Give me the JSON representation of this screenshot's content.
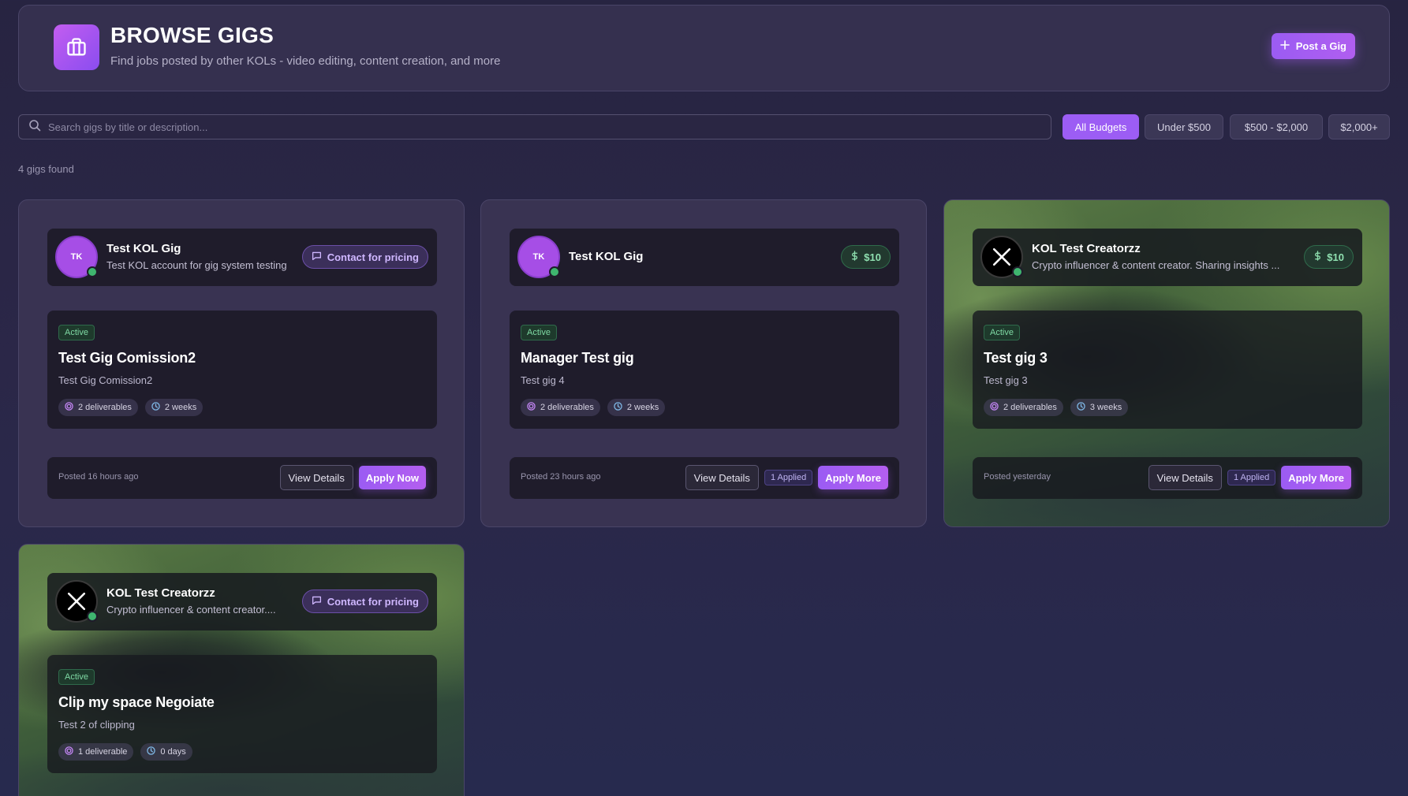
{
  "header": {
    "title": "BROWSE GIGS",
    "subtitle": "Find jobs posted by other KOLs - video editing, content creation, and more",
    "post_button": "Post a Gig",
    "icon": "briefcase-icon"
  },
  "search": {
    "placeholder": "Search gigs by title or description...",
    "value": ""
  },
  "filters": [
    "All Budgets",
    "Under $500",
    "$500 - $2,000",
    "$2,000+"
  ],
  "active_filter": "All Budgets",
  "results_count": "4 gigs found",
  "colors": {
    "accent": "#9c5df4",
    "active_status": "#7fd9a4",
    "online": "#3fb56f"
  },
  "gigs": [
    {
      "author": {
        "initials": "TK",
        "name": "Test KOL Gig",
        "bio": "Test KOL account for gig system testing",
        "avatar": "initials"
      },
      "price": "Contact for pricing",
      "status": "Active",
      "title": "Test Gig Comission2",
      "description": "Test Gig Comission2",
      "deliverables": "2 deliverables",
      "duration": "2 weeks",
      "posted": "Posted 16 hours ago",
      "applied": "",
      "view_label": "View Details",
      "apply_label": "Apply Now"
    },
    {
      "author": {
        "initials": "TK",
        "name": "Test KOL Gig",
        "bio": "",
        "avatar": "initials"
      },
      "price": "$10",
      "status": "Active",
      "title": "Manager Test gig",
      "description": "Test gig 4",
      "deliverables": "2 deliverables",
      "duration": "2 weeks",
      "posted": "Posted 23 hours ago",
      "applied": "1 Applied",
      "view_label": "View Details",
      "apply_label": "Apply More"
    },
    {
      "author": {
        "initials": "X",
        "name": "KOL Test Creatorzz",
        "bio": "Crypto influencer & content creator. Sharing insights ...",
        "avatar": "x-logo"
      },
      "price": "$10",
      "status": "Active",
      "title": "Test gig 3",
      "description": "Test gig 3",
      "deliverables": "2 deliverables",
      "duration": "3 weeks",
      "posted": "Posted yesterday",
      "applied": "1 Applied",
      "view_label": "View Details",
      "apply_label": "Apply More"
    },
    {
      "author": {
        "initials": "X",
        "name": "KOL Test Creatorzz",
        "bio": "Crypto influencer & content creator....",
        "avatar": "x-logo"
      },
      "price": "Contact for pricing",
      "status": "Active",
      "title": "Clip my space Negoiate",
      "description": "Test 2 of clipping",
      "deliverables": "1 deliverable",
      "duration": "0 days",
      "posted": "",
      "applied": "",
      "view_label": "",
      "apply_label": ""
    }
  ]
}
